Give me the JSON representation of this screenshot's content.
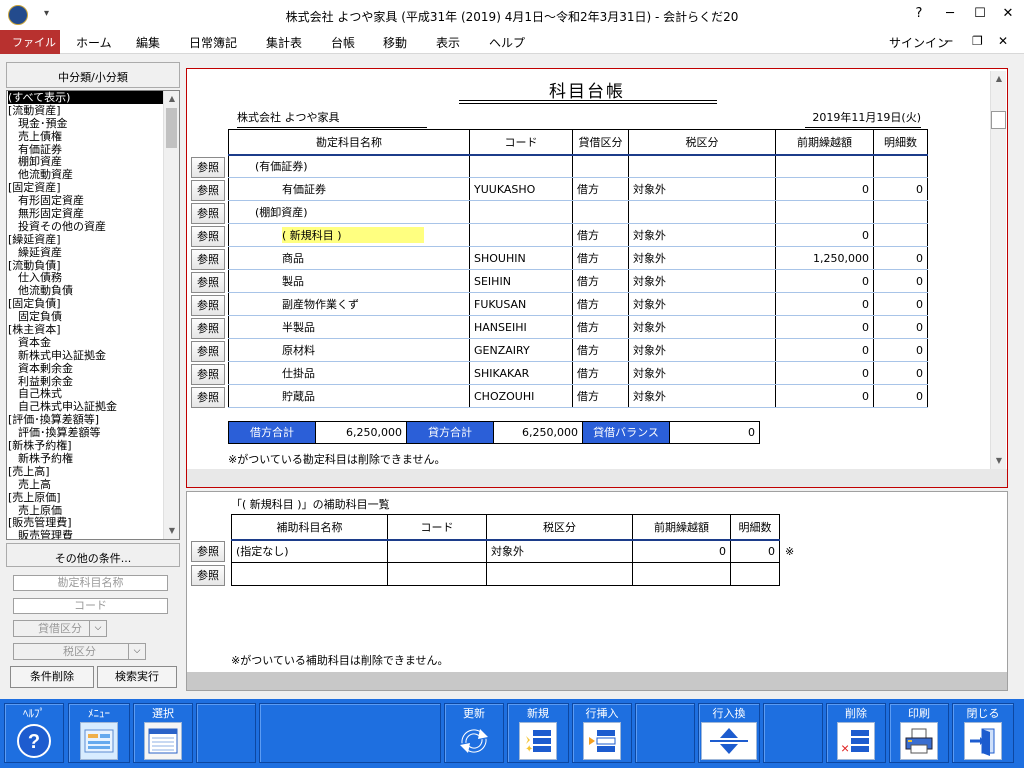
{
  "window": {
    "title": "株式会社 よつや家具 (平成31年 (2019) 4月1日～令和2年3月31日) - 会計らくだ20",
    "help_label": "?",
    "signin_label": "サインイン"
  },
  "menu": [
    "ファイル",
    "ホーム",
    "編集",
    "日常簿記",
    "集計表",
    "台帳",
    "移動",
    "表示",
    "ヘルプ"
  ],
  "sidebar": {
    "header": "中分類/小分類",
    "tree": [
      {
        "label": "(すべて表示)",
        "level": 0,
        "selected": true
      },
      {
        "label": "[流動資産]",
        "level": 0
      },
      {
        "label": "現金･預金",
        "level": 1
      },
      {
        "label": "売上債権",
        "level": 1
      },
      {
        "label": "有価証券",
        "level": 1
      },
      {
        "label": "棚卸資産",
        "level": 1
      },
      {
        "label": "他流動資産",
        "level": 1
      },
      {
        "label": "[固定資産]",
        "level": 0
      },
      {
        "label": "有形固定資産",
        "level": 1
      },
      {
        "label": "無形固定資産",
        "level": 1
      },
      {
        "label": "投資その他の資産",
        "level": 1
      },
      {
        "label": "[繰延資産]",
        "level": 0
      },
      {
        "label": "繰延資産",
        "level": 1
      },
      {
        "label": "[流動負債]",
        "level": 0
      },
      {
        "label": "仕入債務",
        "level": 1
      },
      {
        "label": "他流動負債",
        "level": 1
      },
      {
        "label": "[固定負債]",
        "level": 0
      },
      {
        "label": "固定負債",
        "level": 1
      },
      {
        "label": "[株主資本]",
        "level": 0
      },
      {
        "label": "資本金",
        "level": 1
      },
      {
        "label": "新株式申込証拠金",
        "level": 1
      },
      {
        "label": "資本剰余金",
        "level": 1
      },
      {
        "label": "利益剰余金",
        "level": 1
      },
      {
        "label": "自己株式",
        "level": 1
      },
      {
        "label": "自己株式申込証拠金",
        "level": 1
      },
      {
        "label": "[評価･換算差額等]",
        "level": 0
      },
      {
        "label": "評価･換算差額等",
        "level": 1
      },
      {
        "label": "[新株予約権]",
        "level": 0
      },
      {
        "label": "新株予約権",
        "level": 1
      },
      {
        "label": "[売上高]",
        "level": 0
      },
      {
        "label": "売上高",
        "level": 1
      },
      {
        "label": "[売上原価]",
        "level": 0
      },
      {
        "label": "売上原価",
        "level": 1
      },
      {
        "label": "[販売管理費]",
        "level": 0
      },
      {
        "label": "販売管理費",
        "level": 1
      }
    ],
    "other_conditions": "その他の条件...",
    "account_name_placeholder": "勘定科目名称",
    "code_placeholder": "コード",
    "debit_credit_combo": "貸借区分",
    "tax_combo": "税区分",
    "clear_button": "条件削除",
    "search_button": "検索実行"
  },
  "ledger": {
    "title": "科目台帳",
    "company": "株式会社 よつや家具",
    "date": "2019年11月19日(火)",
    "ref_label": "参照",
    "headers": [
      "勘定科目名称",
      "コード",
      "貸借区分",
      "税区分",
      "前期繰越額",
      "明細数"
    ],
    "rows": [
      {
        "name": "(有価証券)",
        "code": "",
        "dc": "",
        "tax": "",
        "balance": "",
        "count": "",
        "kind": "group"
      },
      {
        "name": "有価証券",
        "code": "YUUKASHO",
        "dc": "借方",
        "tax": "対象外",
        "balance": "0",
        "count": "0",
        "kind": "item"
      },
      {
        "name": "(棚卸資産)",
        "code": "",
        "dc": "",
        "tax": "",
        "balance": "",
        "count": "",
        "kind": "group"
      },
      {
        "name": "( 新規科目 )",
        "code": "",
        "dc": "借方",
        "tax": "対象外",
        "balance": "0",
        "count": "",
        "kind": "new"
      },
      {
        "name": "商品",
        "code": "SHOUHIN",
        "dc": "借方",
        "tax": "対象外",
        "balance": "1,250,000",
        "count": "0",
        "kind": "item"
      },
      {
        "name": "製品",
        "code": "SEIHIN",
        "dc": "借方",
        "tax": "対象外",
        "balance": "0",
        "count": "0",
        "kind": "item"
      },
      {
        "name": "副産物作業くず",
        "code": "FUKUSAN",
        "dc": "借方",
        "tax": "対象外",
        "balance": "0",
        "count": "0",
        "kind": "item"
      },
      {
        "name": "半製品",
        "code": "HANSEIHI",
        "dc": "借方",
        "tax": "対象外",
        "balance": "0",
        "count": "0",
        "kind": "item"
      },
      {
        "name": "原材料",
        "code": "GENZAIRY",
        "dc": "借方",
        "tax": "対象外",
        "balance": "0",
        "count": "0",
        "kind": "item"
      },
      {
        "name": "仕掛品",
        "code": "SHIKAKAR",
        "dc": "借方",
        "tax": "対象外",
        "balance": "0",
        "count": "0",
        "kind": "item"
      },
      {
        "name": "貯蔵品",
        "code": "CHOZOUHI",
        "dc": "借方",
        "tax": "対象外",
        "balance": "0",
        "count": "0",
        "kind": "item"
      }
    ],
    "totals": {
      "debit_label": "借方合計",
      "debit_value": "6,250,000",
      "credit_label": "貸方合計",
      "credit_value": "6,250,000",
      "balance_label": "貸借バランス",
      "balance_value": "0"
    },
    "note": "※がついている勘定科目は削除できません。"
  },
  "sub": {
    "title": "「( 新規科目 )」の補助科目一覧",
    "headers": [
      "補助科目名称",
      "コード",
      "税区分",
      "前期繰越額",
      "明細数"
    ],
    "rows": [
      {
        "name": "(指定なし)",
        "code": "",
        "tax": "対象外",
        "balance": "0",
        "count": "0",
        "mark": "※"
      },
      {
        "name": "",
        "code": "",
        "tax": "",
        "balance": "",
        "count": "",
        "mark": ""
      }
    ],
    "note": "※がついている補助科目は削除できません。"
  },
  "toolbar": {
    "help": "ﾍﾙﾌﾟ",
    "menu": "ﾒﾆｭｰ",
    "select": "選択",
    "refresh": "更新",
    "new": "新規",
    "insert_row": "行挿入",
    "swap_row": "行入換",
    "delete": "削除",
    "print": "印刷",
    "close": "閉じる"
  }
}
